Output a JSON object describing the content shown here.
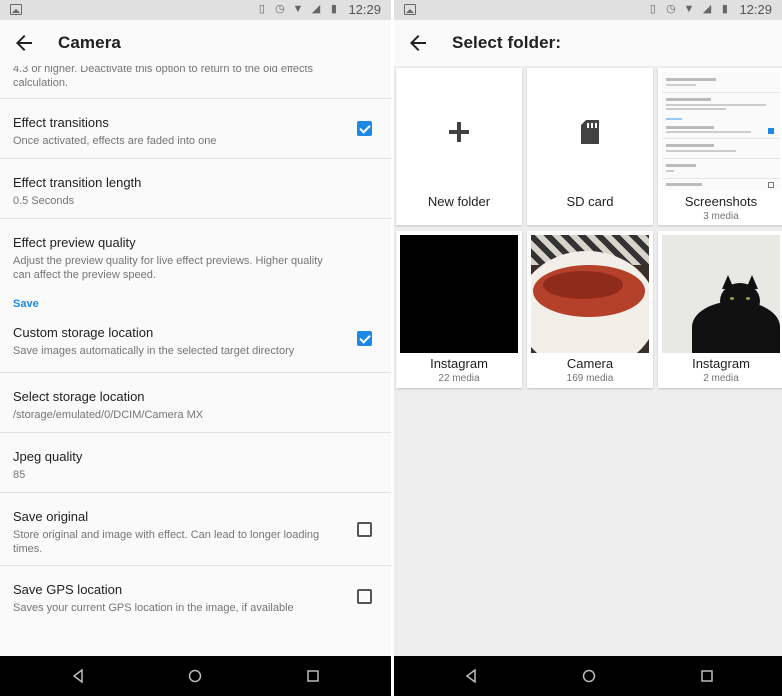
{
  "status": {
    "time": "12:29"
  },
  "left": {
    "title": "Camera",
    "partial_text": "4.3 or higher. Deactivate this option to return to the old effects calculation.",
    "items_top": [
      {
        "title": "Effect transitions",
        "summary": "Once activated, effects are faded into one",
        "checked": true
      },
      {
        "title": "Effect transition length",
        "summary": "0.5 Seconds"
      },
      {
        "title": "Effect preview quality",
        "summary": "Adjust the preview quality for live effect previews. Higher quality can affect the preview speed."
      }
    ],
    "section_save": "Save",
    "items_save": [
      {
        "title": "Custom storage location",
        "summary": "Save images automatically in the selected target directory",
        "checked": true
      },
      {
        "title": "Select storage location",
        "summary": "/storage/emulated/0/DCIM/Camera MX"
      },
      {
        "title": "Jpeg quality",
        "summary": "85"
      },
      {
        "title": "Save original",
        "summary": "Store original and image with effect. Can lead to longer loading times.",
        "checked": false
      },
      {
        "title": "Save GPS location",
        "summary": "Saves your current GPS location in the image, if available",
        "checked": false
      }
    ]
  },
  "right": {
    "title": "Select folder:",
    "folders": [
      {
        "label": "New folder",
        "icon": "plus-icon"
      },
      {
        "label": "SD card",
        "icon": "sd-card-icon"
      },
      {
        "label": "Screenshots",
        "count": "3 media"
      },
      {
        "label": "Instagram",
        "count": "22 media"
      },
      {
        "label": "Camera",
        "count": "169 media"
      },
      {
        "label": "Instagram",
        "count": "2 media"
      }
    ]
  }
}
